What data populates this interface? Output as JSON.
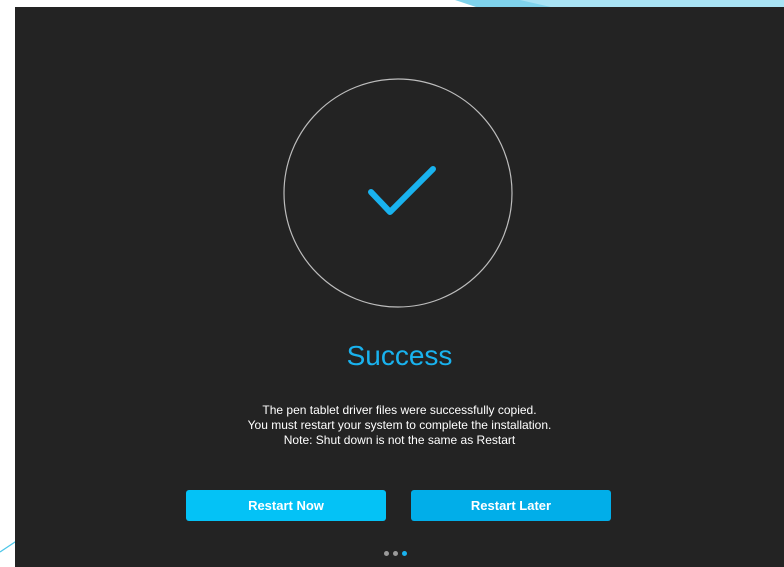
{
  "colors": {
    "dialog_bg": "#232323",
    "accent": "#19b2ee",
    "button_primary": "#04c2f6",
    "button_secondary": "#01aee9",
    "dot_inactive": "#9a9a9a",
    "dot_active": "#19b2ee"
  },
  "dialog": {
    "title": "Success",
    "message_lines": [
      "The pen tablet driver files were successfully copied.",
      "You must restart your system to complete the installation.",
      "Note: Shut down is not the same as Restart"
    ],
    "buttons": {
      "restart_now": "Restart Now",
      "restart_later": "Restart Later"
    },
    "icon": "checkmark-icon"
  },
  "pagination": {
    "total": 3,
    "active_index": 3
  }
}
